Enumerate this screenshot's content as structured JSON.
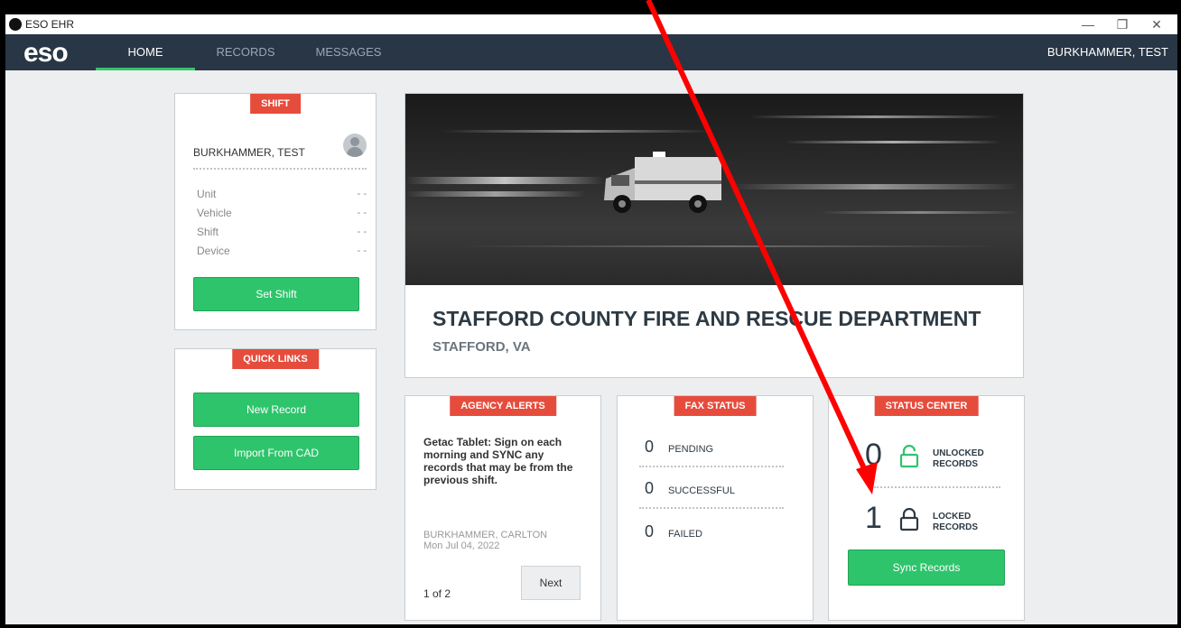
{
  "window": {
    "title": "ESO EHR",
    "minimize": "—",
    "restore": "❐",
    "close": "✕"
  },
  "nav": {
    "logo": "eso",
    "tabs": [
      "HOME",
      "RECORDS",
      "MESSAGES"
    ],
    "user": "BURKHAMMER, TEST"
  },
  "shift": {
    "tag": "SHIFT",
    "name": "BURKHAMMER, TEST",
    "fields": [
      {
        "label": "Unit",
        "value": "- -"
      },
      {
        "label": "Vehicle",
        "value": "- -"
      },
      {
        "label": "Shift",
        "value": "- -"
      },
      {
        "label": "Device",
        "value": "- -"
      }
    ],
    "button": "Set Shift"
  },
  "quick_links": {
    "tag": "QUICK LINKS",
    "new_record": "New Record",
    "import": "Import From CAD"
  },
  "agency": {
    "name": "STAFFORD COUNTY FIRE AND RESCUE DEPARTMENT",
    "location": "STAFFORD, VA"
  },
  "alerts": {
    "tag": "AGENCY ALERTS",
    "message": "Getac Tablet: Sign on each morning and SYNC any records that may be from the previous shift.",
    "author": "BURKHAMMER, CARLTON",
    "date": "Mon Jul 04, 2022",
    "page": "1 of 2",
    "next": "Next"
  },
  "fax": {
    "tag": "FAX STATUS",
    "rows": [
      {
        "count": "0",
        "label": "PENDING"
      },
      {
        "count": "0",
        "label": "SUCCESSFUL"
      },
      {
        "count": "0",
        "label": "FAILED"
      }
    ]
  },
  "status": {
    "tag": "STATUS CENTER",
    "unlocked": {
      "count": "0",
      "label1": "UNLOCKED",
      "label2": "RECORDS"
    },
    "locked": {
      "count": "1",
      "label1": "LOCKED",
      "label2": "RECORDS"
    },
    "sync": "Sync Records"
  },
  "colors": {
    "nav": "#283645",
    "accent_green": "#2ec46b",
    "tag_red": "#e64c3c",
    "arrow_red": "#ff0000"
  }
}
